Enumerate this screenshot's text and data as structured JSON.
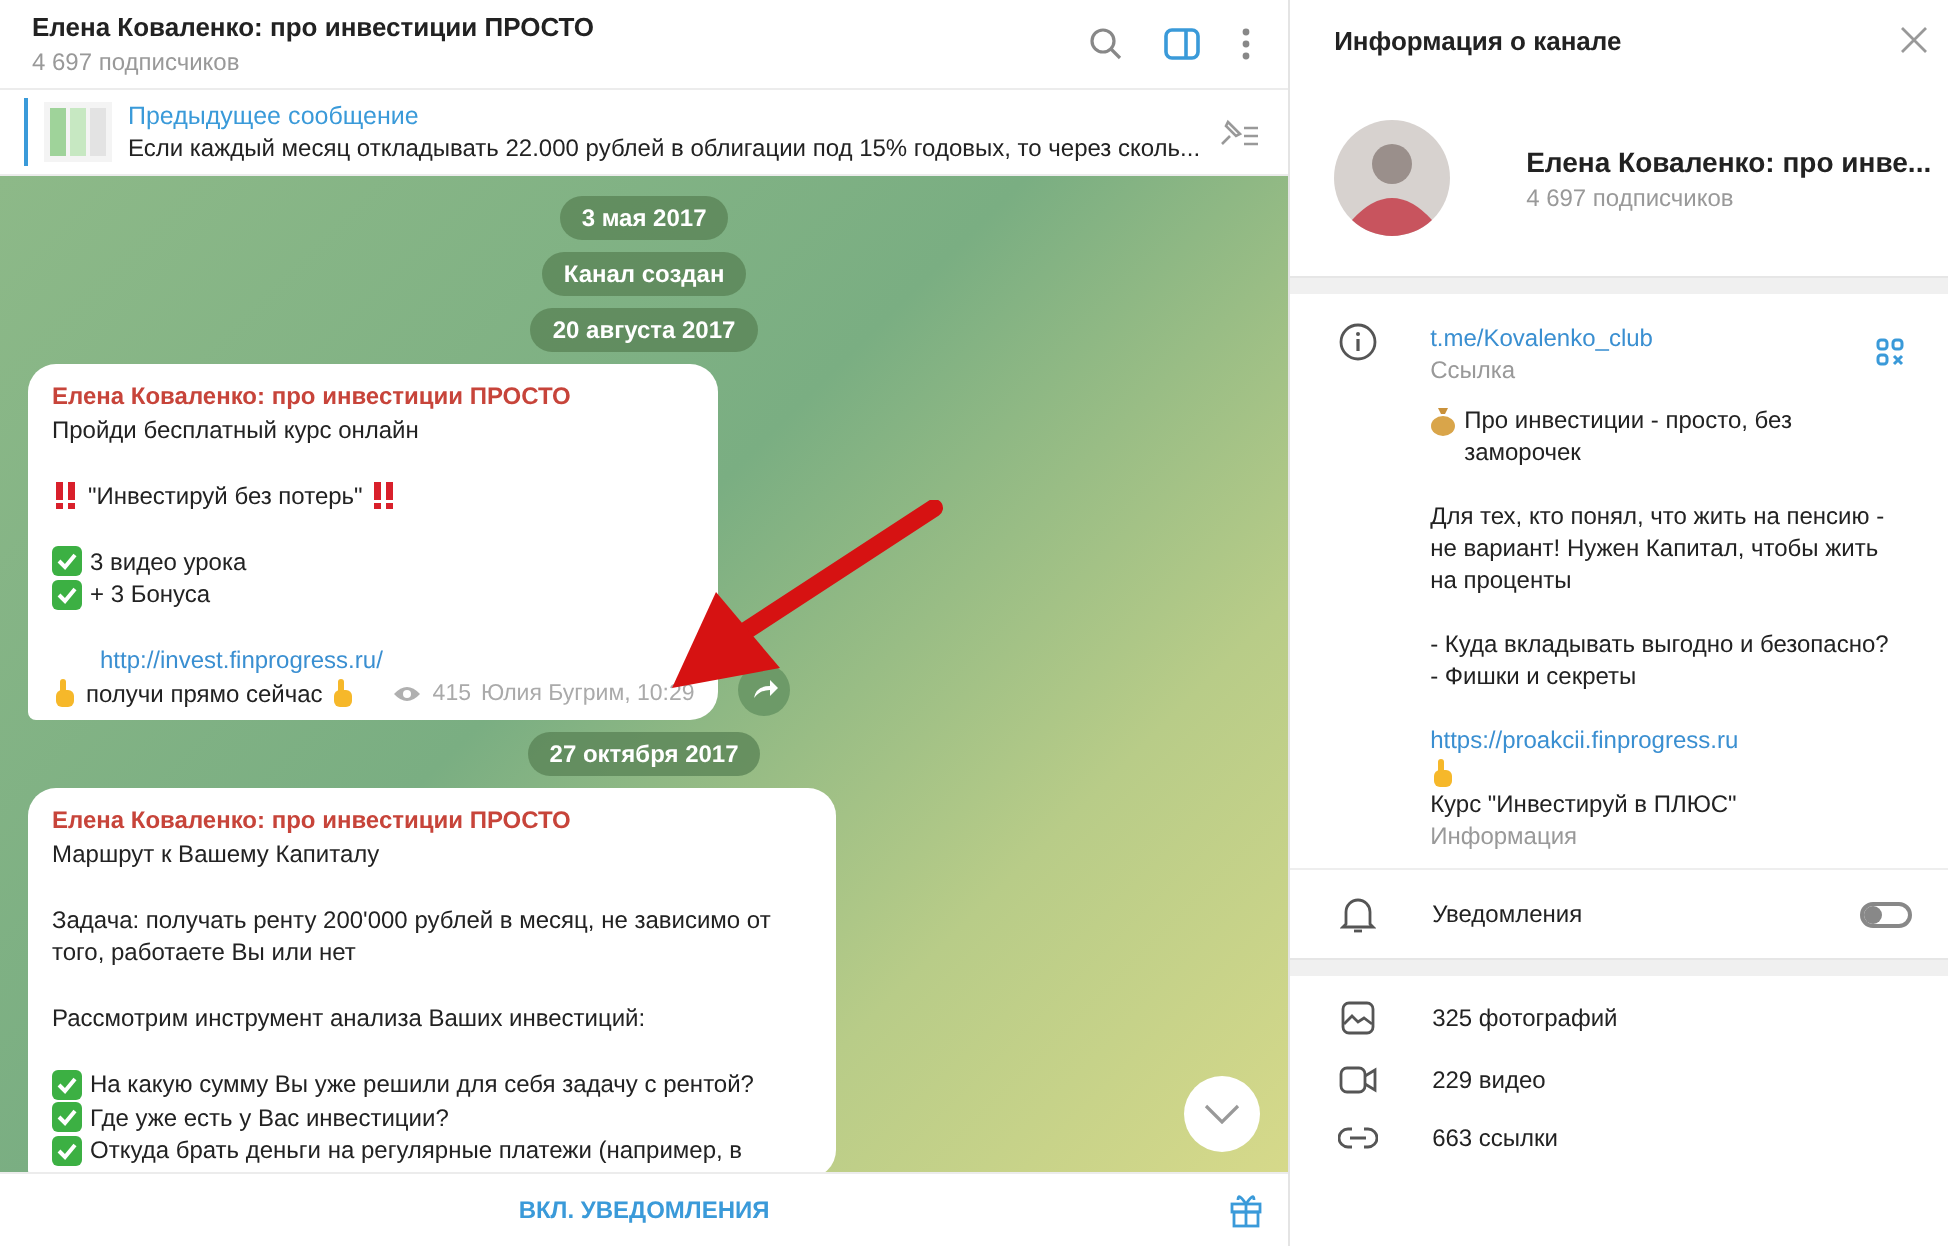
{
  "chat": {
    "title": "Елена Коваленко: про инвестиции ПРОСТО",
    "subtitle": "4 697 подписчиков",
    "pinned": {
      "label": "Предыдущее сообщение",
      "text": "Если каждый месяц откладывать 22.000 рублей в облигации под 15% годовых, то через сколь..."
    },
    "feed": [
      {
        "kind": "date",
        "text": "3 мая 2017"
      },
      {
        "kind": "date",
        "text": "Канал создан"
      },
      {
        "kind": "date",
        "text": "20 августа 2017"
      },
      {
        "kind": "post",
        "author": "Елена Коваленко: про инвестиции ПРОСТО",
        "views": "415",
        "signature": "Юлия Бугрим, 10:29",
        "forward": true,
        "lines": [
          {
            "kind": "text",
            "text": "Пройди бесплатный курс онлайн"
          },
          {
            "kind": "blank"
          },
          {
            "kind": "bangs",
            "text": "\"Инвестируй без потерь\""
          },
          {
            "kind": "blank"
          },
          {
            "kind": "check",
            "text": "3 видео урока"
          },
          {
            "kind": "check",
            "text": "+ 3 Бонуса"
          },
          {
            "kind": "blank"
          },
          {
            "kind": "link",
            "text": "http://invest.finprogress.ru/"
          },
          {
            "kind": "hands",
            "text": "получи прямо сейчас"
          }
        ]
      },
      {
        "kind": "date",
        "text": "27 октября 2017"
      },
      {
        "kind": "post",
        "author": "Елена Коваленко: про инвестиции ПРОСТО",
        "forward": false,
        "lines": [
          {
            "kind": "text",
            "text": "Маршрут к Вашему Капиталу"
          },
          {
            "kind": "blank"
          },
          {
            "kind": "text",
            "text": "Задача: получать ренту 200'000 рублей в месяц, не зависимо от того, работаете Вы или нет"
          },
          {
            "kind": "blank"
          },
          {
            "kind": "text",
            "text": "Рассмотрим инструмент анализа Ваших инвестиций:"
          },
          {
            "kind": "blank"
          },
          {
            "kind": "check",
            "text": "На какую сумму Вы уже решили для себя задачу с рентой?"
          },
          {
            "kind": "check",
            "text": "Где уже есть у Вас инвестиции?"
          },
          {
            "kind": "check",
            "text": "Откуда брать деньги на регулярные платежи (например, в"
          }
        ]
      }
    ],
    "footer": {
      "action": "ВКЛ. УВЕДОМЛЕНИЯ"
    }
  },
  "info": {
    "title": "Информация о канале",
    "name": "Елена Коваленко: про инве...",
    "subscribers": "4 697 подписчиков",
    "link": {
      "text": "t.me/Kovalenko_club",
      "caption": "Ссылка"
    },
    "description": [
      {
        "kind": "money",
        "text": "Про инвестиции - просто, без заморочек"
      },
      {
        "kind": "blank"
      },
      {
        "kind": "text",
        "text": "Для тех, кто понял, что жить на пенсию - не вариант! Нужен Капитал, чтобы жить на проценты"
      },
      {
        "kind": "blank"
      },
      {
        "kind": "text",
        "text": "- Куда вкладывать выгодно и безопасно?"
      },
      {
        "kind": "text",
        "text": "- Фишки и секреты"
      },
      {
        "kind": "blank"
      },
      {
        "kind": "link",
        "text": "https://proakcii.finprogress.ru"
      },
      {
        "kind": "finger"
      },
      {
        "kind": "text",
        "text": "Курс \"Инвестируй в ПЛЮС\""
      }
    ],
    "description_caption": "Информация",
    "notifications": {
      "label": "Уведомления",
      "on": false
    },
    "media": [
      {
        "kind": "photos",
        "text": "325 фотографий"
      },
      {
        "kind": "videos",
        "text": "229 видео"
      },
      {
        "kind": "links",
        "text": "663 ссылки"
      }
    ]
  }
}
